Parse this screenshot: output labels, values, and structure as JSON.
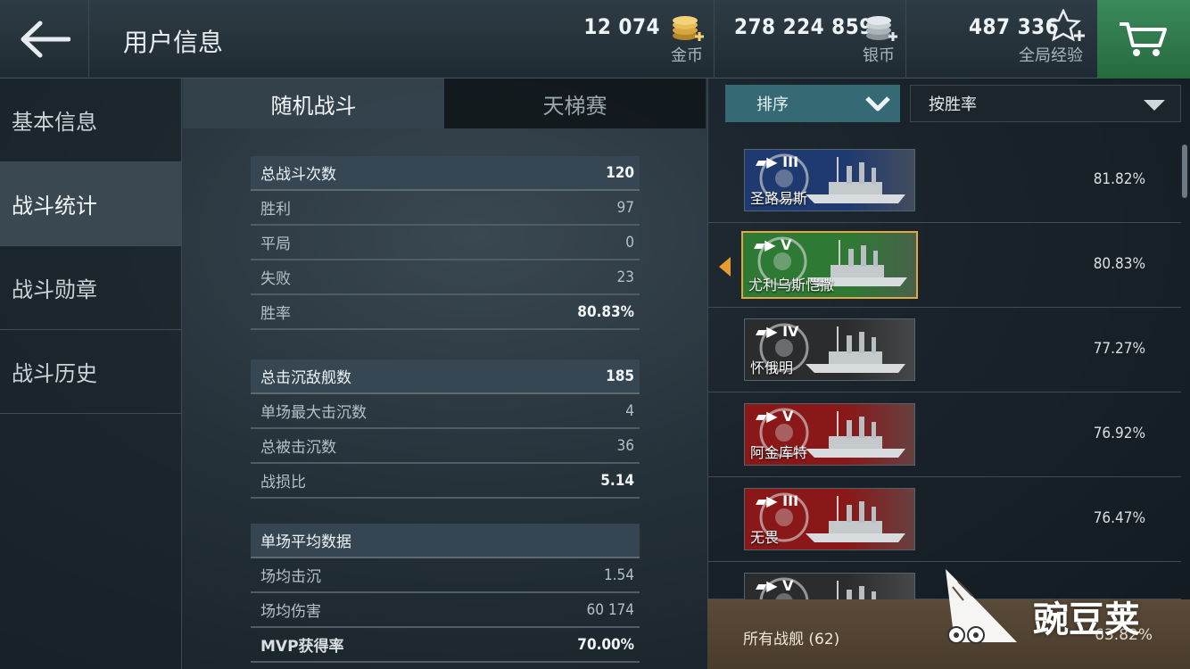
{
  "header": {
    "title": "用户信息",
    "currencies": [
      {
        "amount": "12 074",
        "label": "金币",
        "icon": "gold-coins-icon"
      },
      {
        "amount": "278 224 859",
        "label": "银币",
        "icon": "silver-coins-icon"
      },
      {
        "amount": "487 336",
        "label": "全局经验",
        "icon": "global-xp-star-icon"
      }
    ]
  },
  "sidebar": {
    "items": [
      {
        "label": "基本信息"
      },
      {
        "label": "战斗统计"
      },
      {
        "label": "战斗勋章"
      },
      {
        "label": "战斗历史"
      }
    ],
    "active": "战斗统计"
  },
  "tabs": [
    {
      "label": "随机战斗",
      "active": true
    },
    {
      "label": "天梯赛",
      "active": false
    }
  ],
  "stats": {
    "group1": [
      {
        "k": "总战斗次数",
        "v": "120"
      },
      {
        "k": "胜利",
        "v": "97"
      },
      {
        "k": "平局",
        "v": "0"
      },
      {
        "k": "失败",
        "v": "23"
      },
      {
        "k": "胜率",
        "v": "80.83%"
      }
    ],
    "group2": [
      {
        "k": "总击沉敌舰数",
        "v": "185"
      },
      {
        "k": "单场最大击沉数",
        "v": "4"
      },
      {
        "k": "总被击沉数",
        "v": "36"
      },
      {
        "k": "战损比",
        "v": "5.14"
      }
    ],
    "group3": [
      {
        "k": "单场平均数据",
        "v": ""
      },
      {
        "k": "场均击沉",
        "v": "1.54"
      },
      {
        "k": "场均伤害",
        "v": "60 174"
      },
      {
        "k": "MVP获得率",
        "v": "70.00%"
      }
    ]
  },
  "sort": {
    "button_label": "排序",
    "select_value": "按胜率"
  },
  "ships": [
    {
      "name": "圣路易斯",
      "tier": "III",
      "pct": "81.82%",
      "flag": "usa",
      "bg": "#1f3a70"
    },
    {
      "name": "尤利乌斯恺撒",
      "tier": "V",
      "pct": "80.83%",
      "flag": "italy",
      "bg": "#2e7a34"
    },
    {
      "name": "怀俄明",
      "tier": "IV",
      "pct": "77.27%",
      "flag": "usa",
      "bg": "#2a2c2e"
    },
    {
      "name": "阿金库特",
      "tier": "V",
      "pct": "76.92%",
      "flag": "uk",
      "bg": "#8a1818"
    },
    {
      "name": "无畏",
      "tier": "III",
      "pct": "76.47%",
      "flag": "uk",
      "bg": "#8a1818"
    },
    {
      "name": "",
      "tier": "V",
      "pct": "",
      "flag": "other",
      "bg": "#2a2c2e"
    }
  ],
  "footer": {
    "label": "所有战舰 (62)",
    "pct": "63.82%"
  },
  "watermark": {
    "text": "豌豆荚"
  },
  "colors": {
    "cart_green": "#2f7a4b",
    "sort_teal": "#356a75",
    "selected_border": "#e0a840",
    "footer_brown": "#524233"
  }
}
